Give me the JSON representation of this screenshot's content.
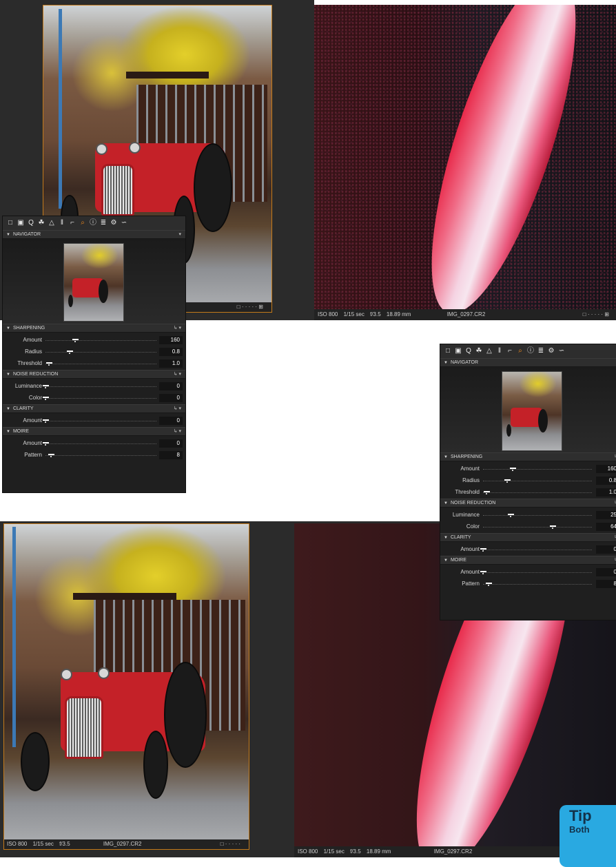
{
  "top_row": {
    "photo_status_dots": "□  ·  ·  ·  ·  ·  ⊞",
    "zoom_status": {
      "iso": "ISO 800",
      "shutter": "1/15 sec",
      "aperture": "f/3.5",
      "focal": "18.89 mm",
      "file": "IMG_0297.CR2",
      "dots": "□  ·  ·  ·  ·  ·  ⊞"
    }
  },
  "bottom_row": {
    "photo_status": {
      "iso": "ISO 800",
      "shutter": "1/15 sec",
      "aperture": "f/3.5",
      "file": "IMG_0297.CR2",
      "dots": "□  ·  ·  ·  ·  ·"
    },
    "zoom_status": {
      "iso": "ISO 800",
      "shutter": "1/15 sec",
      "aperture": "f/3.5",
      "focal": "18.89 mm",
      "file": "IMG_0297.CR2"
    }
  },
  "toolbar_icons": [
    "folder-icon",
    "camera-icon",
    "search-icon",
    "color-icon",
    "exposure-icon",
    "lens-icon",
    "crop-icon",
    "details-icon",
    "info-icon",
    "metadata-icon",
    "settings-icon",
    "batch-icon"
  ],
  "panel_left": {
    "navigator_title": "NAVIGATOR",
    "sharpening": {
      "title": "SHARPENING",
      "amount_label": "Amount",
      "amount": "160",
      "amount_frac": 0.27,
      "radius_label": "Radius",
      "radius": "0.8",
      "radius_frac": 0.22,
      "threshold_label": "Threshold",
      "threshold": "1.0",
      "threshold_frac": 0.03
    },
    "noise": {
      "title": "NOISE REDUCTION",
      "luminance_label": "Luminance",
      "luminance": "0",
      "luminance_frac": 0.0,
      "color_label": "Color",
      "color": "0",
      "color_frac": 0.0
    },
    "clarity": {
      "title": "CLARITY",
      "amount_label": "Amount",
      "amount": "0",
      "amount_frac": 0.0
    },
    "moire": {
      "title": "MOIRE",
      "amount_label": "Amount",
      "amount": "0",
      "amount_frac": 0.0,
      "pattern_label": "Pattern",
      "pattern": "8",
      "pattern_frac": 0.05
    }
  },
  "panel_right": {
    "navigator_title": "NAVIGATOR",
    "sharpening": {
      "title": "SHARPENING",
      "amount_label": "Amount",
      "amount": "160",
      "amount_frac": 0.27,
      "radius_label": "Radius",
      "radius": "0.8",
      "radius_frac": 0.22,
      "threshold_label": "Threshold",
      "threshold": "1.0",
      "threshold_frac": 0.03
    },
    "noise": {
      "title": "NOISE REDUCTION",
      "luminance_label": "Luminance",
      "luminance": "25",
      "luminance_frac": 0.25,
      "color_label": "Color",
      "color": "64",
      "color_frac": 0.64
    },
    "clarity": {
      "title": "CLARITY",
      "amount_label": "Amount",
      "amount": "0",
      "amount_frac": 0.0
    },
    "moire": {
      "title": "MOIRE",
      "amount_label": "Amount",
      "amount": "0",
      "amount_frac": 0.0,
      "pattern_label": "Pattern",
      "pattern": "8",
      "pattern_frac": 0.05
    }
  },
  "tip": {
    "title": "Tip",
    "line": "Both"
  },
  "colors": {
    "accent": "#f08a1c",
    "panel_bg": "#1f1f1f",
    "tip_bg": "#29a9e1"
  }
}
